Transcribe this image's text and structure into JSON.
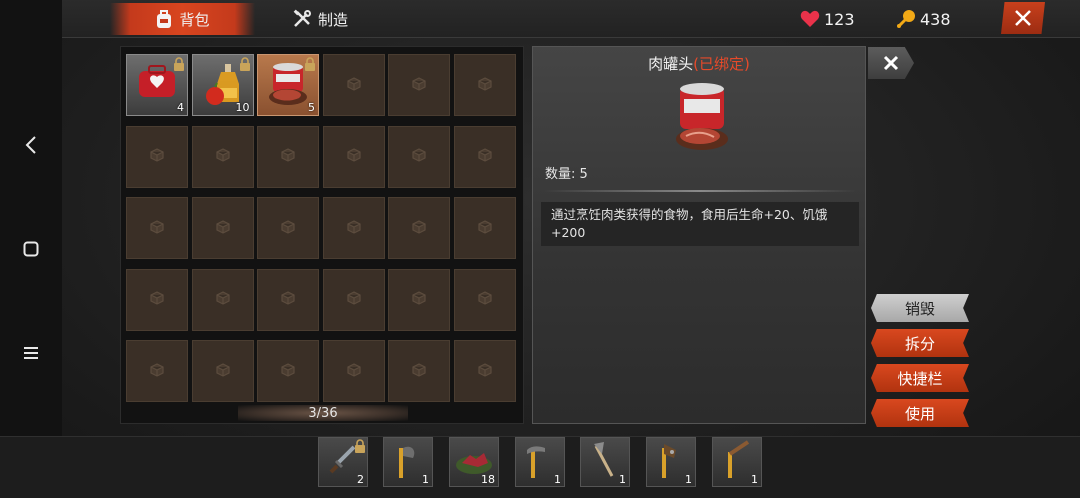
{
  "header": {
    "tabs": [
      {
        "label": "背包",
        "active": true
      },
      {
        "label": "制造",
        "active": false
      }
    ],
    "health": "123",
    "coins": "438",
    "accent_color": "#d8451f"
  },
  "inventory": {
    "capacity_text": "3/36",
    "items": [
      {
        "name": "medkit",
        "count": "4",
        "locked": true
      },
      {
        "name": "oil-bottle-with-apple",
        "count": "10",
        "locked": true
      },
      {
        "name": "canned-meat",
        "count": "5",
        "locked": true,
        "selected": true
      }
    ]
  },
  "detail": {
    "title": "肉罐头",
    "bound_tag": "(已绑定)",
    "quantity_text": "数量: 5",
    "description": "通过烹饪肉类获得的食物，食用后生命+20、饥饿+200"
  },
  "actions": [
    {
      "label": "销毁",
      "style": "grey"
    },
    {
      "label": "拆分",
      "style": "red"
    },
    {
      "label": "快捷栏",
      "style": "red"
    },
    {
      "label": "使用",
      "style": "red"
    }
  ],
  "quickbar": [
    {
      "icon": "dagger-icon",
      "count": "2",
      "locked": true
    },
    {
      "icon": "stone-axe-icon",
      "count": "1",
      "locked": false
    },
    {
      "icon": "raw-meat-icon",
      "count": "18",
      "locked": false
    },
    {
      "icon": "stone-pickaxe-icon",
      "count": "1",
      "locked": false
    },
    {
      "icon": "hatchet-icon",
      "count": "1",
      "locked": false
    },
    {
      "icon": "spiked-club-icon",
      "count": "1",
      "locked": false
    },
    {
      "icon": "wooden-spear-icon",
      "count": "1",
      "locked": false
    }
  ]
}
